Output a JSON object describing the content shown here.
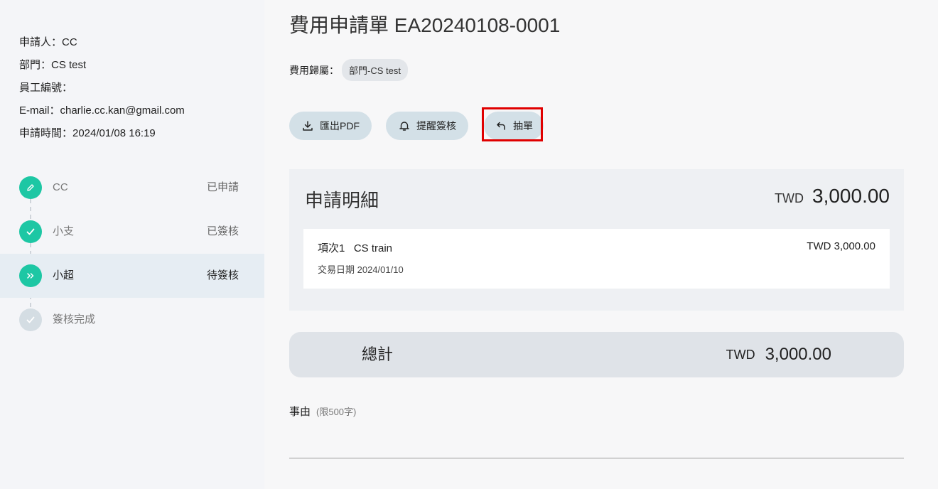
{
  "applicant": {
    "name_line": "申請人：CC",
    "dept_line": "部門：CS test",
    "employee_no_line": "員工編號：",
    "email_line": "E-mail：charlie.cc.kan@gmail.com",
    "time_line": "申請時間：2024/01/08 16:19"
  },
  "steps": [
    {
      "name": "CC",
      "status": "已申請",
      "icon": "pencil-icon"
    },
    {
      "name": "小支",
      "status": "已簽核",
      "icon": "check-icon"
    },
    {
      "name": "小超",
      "status": "待簽核",
      "icon": "chevrons-right-icon"
    },
    {
      "name": "簽核完成",
      "status": "",
      "icon": "check-icon"
    }
  ],
  "form": {
    "title": "費用申請單 EA20240108-0001",
    "belong_label": "費用歸屬：",
    "belong_value": "部門-CS test"
  },
  "actions": {
    "export_pdf": "匯出PDF",
    "remind": "提醒簽核",
    "withdraw": "抽單"
  },
  "detail": {
    "title": "申請明細",
    "currency": "TWD",
    "amount": "3,000.00",
    "items": [
      {
        "name": "項次1   CS train",
        "amount": "TWD 3,000.00",
        "date": "交易日期 2024/01/10"
      }
    ]
  },
  "total": {
    "label": "總計",
    "currency": "TWD",
    "amount": "3,000.00"
  },
  "reason": {
    "label": "事由",
    "limit": "(限500字)"
  },
  "colors": {
    "step_done": "#1dc7a4",
    "step_pending": "#d4dde3",
    "button_bg": "#d3e0e7",
    "highlight": "#e00000"
  }
}
